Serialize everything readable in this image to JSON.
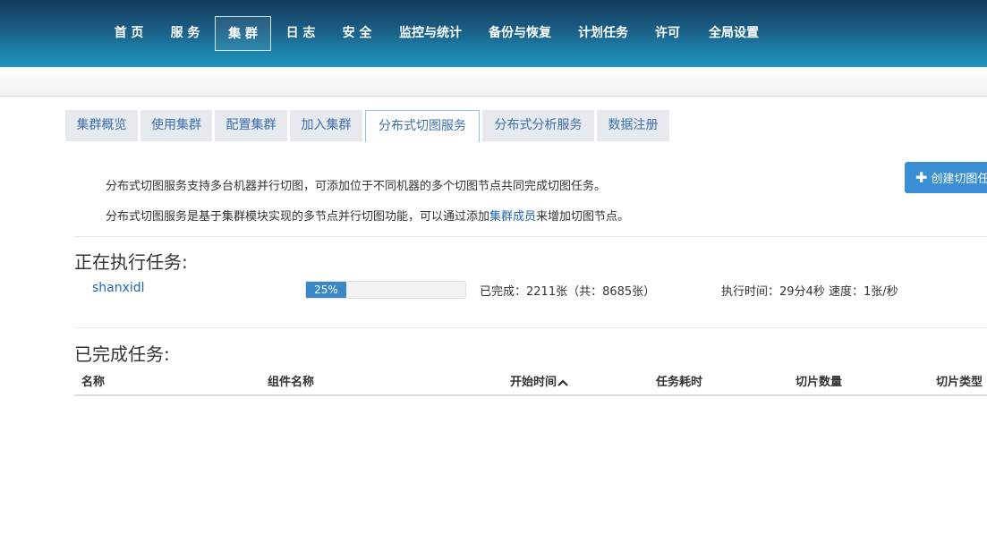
{
  "nav": {
    "items": [
      {
        "label": "首 页"
      },
      {
        "label": "服 务"
      },
      {
        "label": "集 群"
      },
      {
        "label": "日 志"
      },
      {
        "label": "安 全"
      },
      {
        "label": "监控与统计"
      },
      {
        "label": "备份与恢复"
      },
      {
        "label": "计划任务"
      },
      {
        "label": "许可"
      },
      {
        "label": "全局设置"
      }
    ],
    "active": "集 群"
  },
  "tabs": {
    "items": [
      {
        "label": "集群概览"
      },
      {
        "label": "使用集群"
      },
      {
        "label": "配置集群"
      },
      {
        "label": "加入集群"
      },
      {
        "label": "分布式切图服务"
      },
      {
        "label": "分布式分析服务"
      },
      {
        "label": "数据注册"
      }
    ],
    "active": "分布式切图服务"
  },
  "description": {
    "line1": "分布式切图服务支持多台机器并行切图，可添加位于不同机器的多个切图节点共同完成切图任务。",
    "line2_prefix": "分布式切图服务是基于集群模块实现的多节点并行切图功能，可以通过添加",
    "line2_link": "集群成员",
    "line2_suffix": "来增加切图节点。"
  },
  "create_button": {
    "label": "创建切图任务",
    "icon": "plus-icon"
  },
  "running": {
    "title": "正在执行任务:",
    "task": {
      "name": "shanxidl",
      "progress_percent": 25,
      "progress_label": "25%",
      "completed_text": "已完成：2211张（共：8685张）",
      "time_text": "执行时间：29分4秒 速度：1张/秒"
    }
  },
  "completed": {
    "title": "已完成任务:",
    "columns": [
      "名称",
      "组件名称",
      "开始时间",
      "任务耗时",
      "切片数量",
      "切片类型"
    ],
    "sort_icon": "caret-up-icon"
  },
  "colors": {
    "nav_gradient_top": "#163a5c",
    "nav_gradient_bottom": "#1f98c4",
    "link": "#1f66b5",
    "tab_text": "#3b6fae",
    "progress": "#3a87c8",
    "button": "#3a8fd4"
  }
}
